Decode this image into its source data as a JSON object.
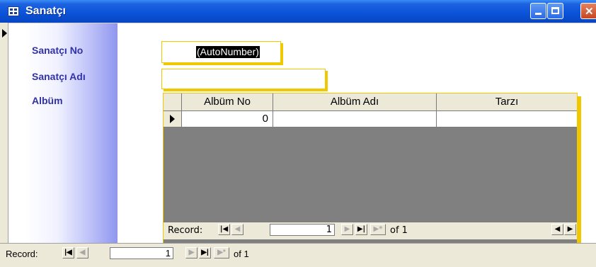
{
  "window": {
    "title": "Sanatçı"
  },
  "form": {
    "labels": {
      "sanatci_no": "Sanatçı No",
      "sanatci_adi": "Sanatçı Adı",
      "album": "Albüm"
    },
    "fields": {
      "sanatci_no": "(AutoNumber)",
      "sanatci_adi": ""
    }
  },
  "subform": {
    "columns": [
      "Albüm No",
      "Albüm Adı",
      "Tarzı"
    ],
    "rows": [
      {
        "album_no": "0",
        "album_adi": "",
        "tarzi": ""
      }
    ],
    "nav": {
      "label": "Record:",
      "current": "1",
      "of_text": "of 1"
    }
  },
  "main_nav": {
    "label": "Record:",
    "current": "1",
    "of_text": "of 1"
  },
  "colors": {
    "accent": "#0a52d8",
    "highlight_border": "#f0c800",
    "label_text": "#3131a8",
    "datasheet_bg": "#808080"
  }
}
